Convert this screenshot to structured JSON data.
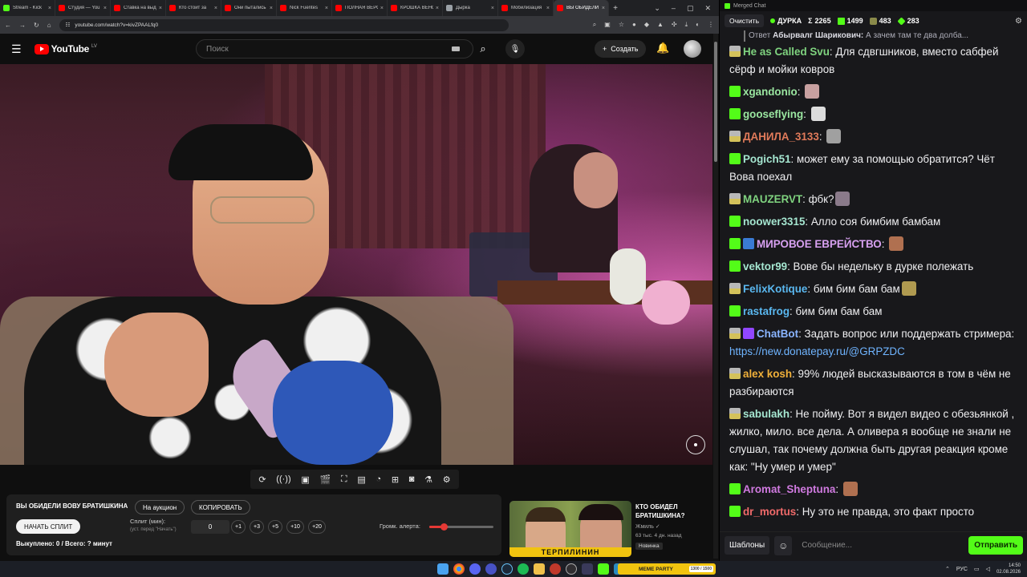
{
  "browser": {
    "tabs": [
      {
        "label": "Stream - Kick",
        "color": "#53fc18"
      },
      {
        "label": "Студия — YouTube",
        "color": "#ff0000"
      },
      {
        "label": "Ставка на выдачу",
        "color": "#ff0000"
      },
      {
        "label": "Кто стоит за",
        "color": "#ff0000"
      },
      {
        "label": "Они пытались",
        "color": "#ff0000"
      },
      {
        "label": "Nick Fuentes",
        "color": "#ff0000"
      },
      {
        "label": "ПОЛНАЯ ВЕРСИЯ",
        "color": "#ff0000"
      },
      {
        "label": "КРОШКА ВЕНОМ",
        "color": "#ff0000"
      },
      {
        "label": "Дырка",
        "color": "#9aa0a6"
      },
      {
        "label": "Мобилизация",
        "color": "#ff0000"
      },
      {
        "label": "ВЫ ОБИДЕЛИ",
        "color": "#ff0000",
        "active": true
      }
    ],
    "url": "youtube.com/watch?v=kivZPAALfq0"
  },
  "youtube": {
    "logo_text": "YouTube",
    "country_code": "LV",
    "search_placeholder": "Поиск",
    "create_label": "Создать"
  },
  "auction": {
    "title": "ВЫ ОБИДЕЛИ ВОВУ БРАТИШКИНА",
    "auction_btn": "На аукцион",
    "copy_btn": "КОПИРОВАТЬ",
    "start_btn": "НАЧАТЬ СПЛИТ",
    "split_label": "Сплит (мин):",
    "split_sub": "(уст. перед \"Начать\")",
    "split_value": "0",
    "increments": [
      "+1",
      "+3",
      "+5",
      "+10",
      "+20"
    ],
    "volume_label": "Громк. алерта:",
    "volume_level": 0.22,
    "bought_text": "Выкуплено: 0 / Всего: ? минут"
  },
  "recommended": {
    "title": "КТО ОБИДЕЛ БРАТИШКИНА?",
    "channel": "Жмиль",
    "meta": "63 тыс.  4 дн. назад",
    "badge": "Новинка",
    "thumb_text": "ТЕРПИЛИНИН"
  },
  "chat": {
    "window_title": "Merged Chat",
    "clear_btn": "Очистить",
    "channel": "ДУРКА",
    "stats": [
      {
        "icon": "sigma",
        "value": "2265"
      },
      {
        "icon": "kick",
        "value": "1499"
      },
      {
        "icon": "viewers",
        "value": "483"
      },
      {
        "icon": "viewers-alt",
        "value": "283"
      }
    ],
    "reply_prefix": "Ответ",
    "reply_user": "Абырвалг Шарикович:",
    "reply_text": "А зачем там те два долба...",
    "messages": [
      {
        "badge": "crown",
        "user": "He as Called Svu",
        "color": "#7fd37f",
        "text": "Для сдвгшников, вместо сабфей сёрф и мойки ковров"
      },
      {
        "badge": "k",
        "user": "xgandonio",
        "color": "#9ae6a0",
        "text": "",
        "emote": "#c8a0a0"
      },
      {
        "badge": "k",
        "user": "gooseflying",
        "color": "#9ae6a0",
        "text": "",
        "emote": "#dcdcdc"
      },
      {
        "badge": "crown",
        "user": "ДАНИЛА_3133",
        "color": "#e07a5a",
        "text": "",
        "emote": "#a0a0a0"
      },
      {
        "badge": "k",
        "user": "Pogich51",
        "color": "#a5e6d0",
        "text": "может ему за помощью обратится? Чёт Вова поехал"
      },
      {
        "badge": "crown",
        "user": "MAUZERVT",
        "color": "#7fd37f",
        "text": "фбк?",
        "emote": "#8a7a8a"
      },
      {
        "badge": "k",
        "user": "noower3315",
        "color": "#a5e6d0",
        "text": "Алло соя бимбим бамбам"
      },
      {
        "badge": "k",
        "badge2": "pick",
        "user": "МИРОВОЕ ЕВРЕЙСТВО",
        "color": "#d7a0f0",
        "text": "",
        "emote": "#b07050"
      },
      {
        "badge": "k",
        "user": "vektor99",
        "color": "#a5e6d0",
        "text": "Вове бы недельку в дурке полежать"
      },
      {
        "badge": "crown",
        "user": "FelixKotique",
        "color": "#5ab8f0",
        "text": "бим бим бам бам",
        "emote": "#b09a50"
      },
      {
        "badge": "k",
        "user": "rastafrog",
        "color": "#5ab8f0",
        "text": "бим бим бам бам"
      },
      {
        "badge": "crown",
        "badge2": "bot",
        "user": "ChatBot",
        "color": "#8ab4ff",
        "text": "Задать вопрос или поддержать стримера: ",
        "link": "https://new.donatepay.ru/@GRPZDC"
      },
      {
        "badge": "crown",
        "user": "alex kosh",
        "color": "#f0b03a",
        "text": "99% людей высказываются в том в чём не разбираются"
      },
      {
        "badge": "crown",
        "user": "sabulakh",
        "color": "#a5e6d0",
        "text": "Не пойму. Вот я видел видео с обезьянкой , жилко, мило. все дела. А оливера я вообще не знали не слушал, так почему должна быть другая реакция  кроме как: \"Ну умер и умер\""
      },
      {
        "badge": "k",
        "user": "Aromat_Sheptuna",
        "color": "#d07ae0",
        "text": "",
        "emote": "#b07050"
      },
      {
        "badge": "k",
        "user": "dr_mortus",
        "color": "#f06a6a",
        "text": "Ну это не правда, это факт просто"
      }
    ],
    "templates_btn": "Шаблоны",
    "input_placeholder": "Сообщение...",
    "send_btn": "Отправить"
  },
  "taskbar": {
    "widget_text": "МЕМЕ PARTY",
    "widget_counter": "1300 / 1500",
    "lang": "РУС",
    "time": "14:50",
    "date": "02.08.2026"
  }
}
